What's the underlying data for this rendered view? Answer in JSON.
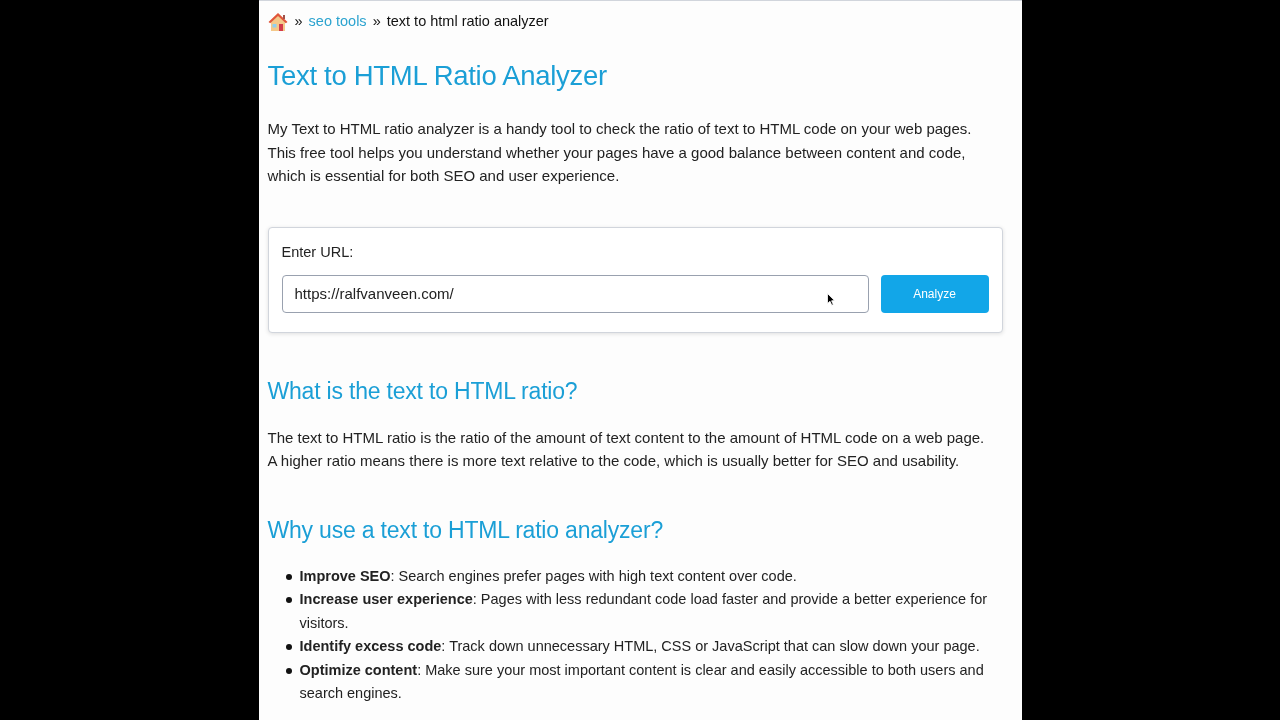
{
  "breadcrumb": {
    "items": [
      {
        "kind": "separator",
        "text": "»"
      },
      {
        "kind": "link",
        "text": "seo tools"
      },
      {
        "kind": "separator",
        "text": "»"
      },
      {
        "kind": "current",
        "text": "text to html ratio analyzer"
      }
    ]
  },
  "title": "Text to HTML Ratio Analyzer",
  "intro": "My Text to HTML ratio analyzer is a handy tool to check the ratio of text to HTML code on your web pages. This free tool helps you understand whether your pages have a good balance between content and code, which is essential for both SEO and user experience.",
  "form": {
    "label": "Enter URL:",
    "value": "https://ralfvanveen.com/",
    "button": "Analyze"
  },
  "sections": [
    {
      "kind": "paragraph",
      "heading": "What is the text to HTML ratio?",
      "text": "The text to HTML ratio is the ratio of the amount of text content to the amount of HTML code on a web page. A higher ratio means there is more text relative to the code, which is usually better for SEO and usability."
    },
    {
      "kind": "list",
      "heading": "Why use a text to HTML ratio analyzer?",
      "items": [
        "**Improve SEO**: Search engines prefer pages with high text content over code.",
        "**Increase user experience**: Pages with less redundant code load faster and provide a better experience for visitors.",
        "**Identify excess code**: Track down unnecessary HTML, CSS or JavaScript that can slow down your page.",
        "**Optimize content**: Make sure your most important content is clear and easily accessible to both users and search engines."
      ]
    }
  ]
}
